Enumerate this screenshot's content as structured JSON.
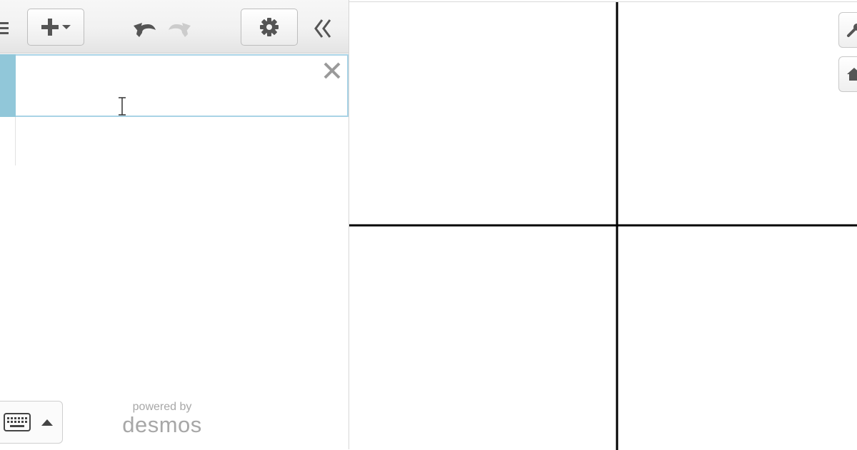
{
  "toolbar": {
    "icons": {
      "menu": "hamburger-icon",
      "add": "plus-icon",
      "add_caret": "caret-down-icon",
      "undo": "undo-icon",
      "redo": "redo-icon",
      "settings": "gear-icon",
      "collapse": "double-chevron-left-icon"
    }
  },
  "expression_list": {
    "items": [
      {
        "value": "",
        "delete_icon": "close-icon",
        "accent_color": "#91c7d9"
      }
    ]
  },
  "footer": {
    "keypad_icons": {
      "keyboard": "keyboard-icon",
      "toggle": "caret-up-icon"
    },
    "powered_by": "powered by",
    "brand": "desmos"
  },
  "graph": {
    "axes_visible": true,
    "grid_visible": false,
    "side_buttons": {
      "wrench": "wrench-icon",
      "home": "home-icon"
    }
  },
  "colors": {
    "expression_accent": "#91c7d9",
    "input_border": "#a9d3e6",
    "icon_gray": "#555555",
    "disabled_gray": "#cccccc",
    "brand_gray": "#a7a7a7"
  }
}
